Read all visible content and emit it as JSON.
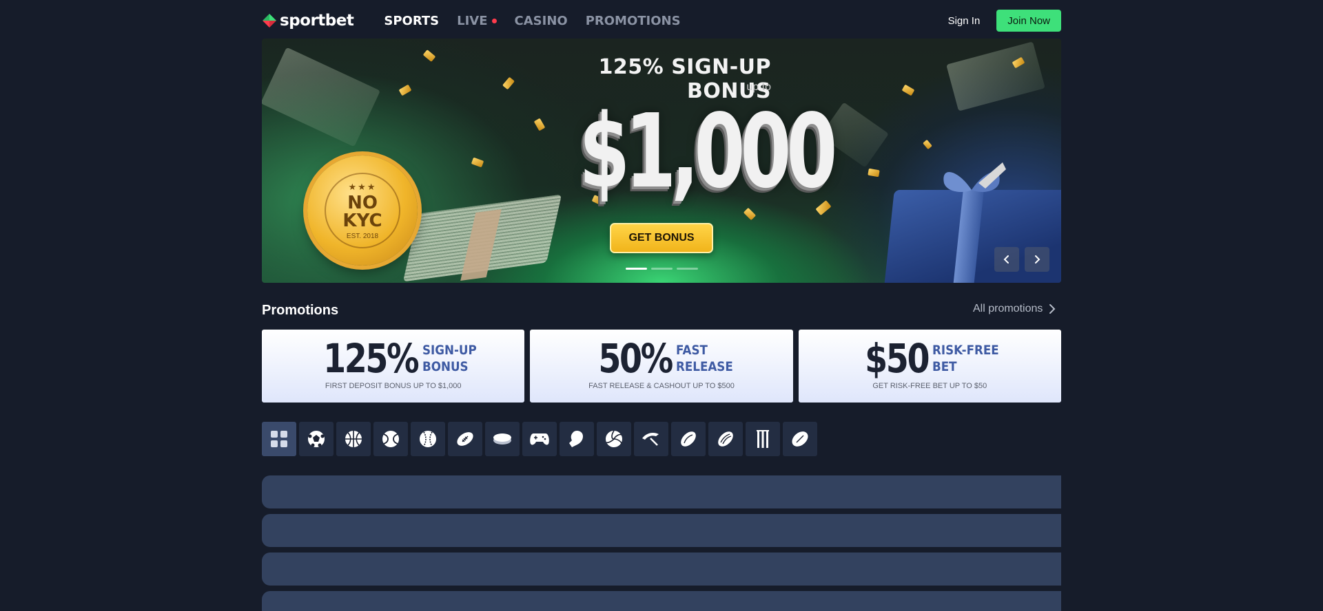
{
  "header": {
    "logo_text": "sportbet",
    "nav": [
      {
        "label": "SPORTS",
        "active": true
      },
      {
        "label": "LIVE",
        "active": false,
        "live": true
      },
      {
        "label": "CASINO",
        "active": false
      },
      {
        "label": "PROMOTIONS",
        "active": false
      }
    ],
    "sign_in": "Sign In",
    "join_now": "Join Now"
  },
  "banner": {
    "headline": "125% SIGN-UP BONUS",
    "up_to": "up to",
    "amount": "$1,000",
    "cta": "GET BONUS",
    "badge": {
      "line1": "NO",
      "line2": "KYC",
      "est": "EST. 2018"
    },
    "slide_count": 3,
    "active_slide": 1
  },
  "promotions": {
    "title": "Promotions",
    "all_link": "All promotions",
    "cards": [
      {
        "big": "125%",
        "sub1": "SIGN-UP",
        "sub2": "BONUS",
        "foot": "FIRST DEPOSIT BONUS UP TO $1,000"
      },
      {
        "big": "50%",
        "sub1": "FAST",
        "sub2": "RELEASE",
        "foot": "FAST RELEASE & CASHOUT UP TO $500"
      },
      {
        "big": "$50",
        "sub1": "RISK-FREE",
        "sub2": "BET",
        "foot": "GET RISK-FREE BET UP TO $50"
      }
    ]
  },
  "sports_bar": {
    "items": [
      "all-sports-icon",
      "soccer-icon",
      "basketball-icon",
      "tennis-icon",
      "baseball-icon",
      "american-football-icon",
      "hockey-puck-icon",
      "esports-controller-icon",
      "boxing-glove-icon",
      "volleyball-icon",
      "ski-jump-icon",
      "rugby-league-icon",
      "rugby-union-icon",
      "cricket-icon",
      "aussie-rules-icon"
    ],
    "active_index": 0
  },
  "colors": {
    "background": "#161c2a",
    "accent_green": "#3ee07a",
    "live_red": "#ff3b4c",
    "cta_yellow": "#f1b41b",
    "card_blue_text": "#3e5aa3",
    "skeleton": "#33425f"
  }
}
